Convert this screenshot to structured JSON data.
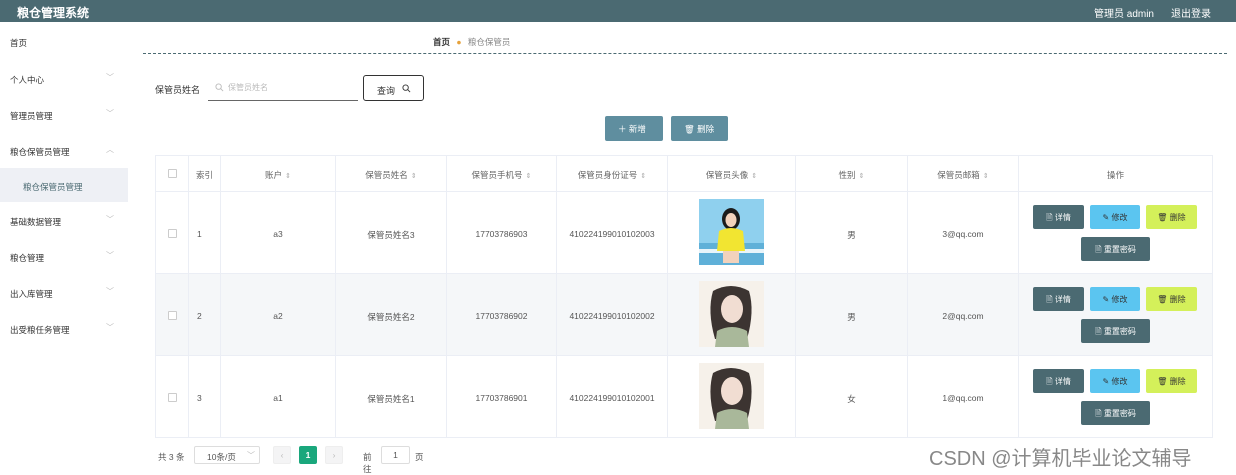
{
  "app": {
    "title": "粮仓管理系统"
  },
  "header": {
    "user": "管理员 admin",
    "logout": "退出登录"
  },
  "sidebar": {
    "items": [
      {
        "label": "首页",
        "chevron": ""
      },
      {
        "label": "个人中心",
        "chevron": "﹀"
      },
      {
        "label": "管理员管理",
        "chevron": "﹀"
      },
      {
        "label": "粮仓保管员管理",
        "chevron": "︿"
      },
      {
        "label": "粮仓保管员管理",
        "chevron": ""
      },
      {
        "label": "基础数据管理",
        "chevron": "﹀"
      },
      {
        "label": "粮仓管理",
        "chevron": "﹀"
      },
      {
        "label": "出入库管理",
        "chevron": "﹀"
      },
      {
        "label": "出受粮任务管理",
        "chevron": "﹀"
      }
    ]
  },
  "breadcrumb": {
    "home": "首页",
    "current": "粮仓保管员"
  },
  "search": {
    "label": "保管员姓名",
    "placeholder": "保管员姓名",
    "button": "查询"
  },
  "actions": {
    "add": "新增",
    "delete": "删除"
  },
  "table": {
    "headers": {
      "index": "索引",
      "account": "账户",
      "name": "保管员姓名",
      "phone": "保管员手机号",
      "idcard": "保管员身份证号",
      "avatar": "保管员头像",
      "gender": "性别",
      "email": "保管员邮箱",
      "ops": "操作"
    },
    "rows": [
      {
        "index": "1",
        "account": "a3",
        "name": "保管员姓名3",
        "phone": "17703786903",
        "idcard": "410224199010102003",
        "gender": "男",
        "email": "3@qq.com"
      },
      {
        "index": "2",
        "account": "a2",
        "name": "保管员姓名2",
        "phone": "17703786902",
        "idcard": "410224199010102002",
        "gender": "男",
        "email": "2@qq.com"
      },
      {
        "index": "3",
        "account": "a1",
        "name": "保管员姓名1",
        "phone": "17703786901",
        "idcard": "410224199010102001",
        "gender": "女",
        "email": "1@qq.com"
      }
    ],
    "row_ops": {
      "detail": "详情",
      "edit": "修改",
      "delete": "删除",
      "reset": "重置密码"
    }
  },
  "pagination": {
    "total": "共 3 条",
    "page_size": "10条/页",
    "current_page": "1",
    "goto": "前往",
    "goto_value": "1",
    "unit": "页"
  },
  "watermark": "CSDN @计算机毕业论文辅导",
  "colors": {
    "header": "#4b6a72",
    "accent": "#1aa77c",
    "button": "#5f8e9f",
    "edit": "#5bc5f0",
    "delete": "#d4f05a"
  }
}
